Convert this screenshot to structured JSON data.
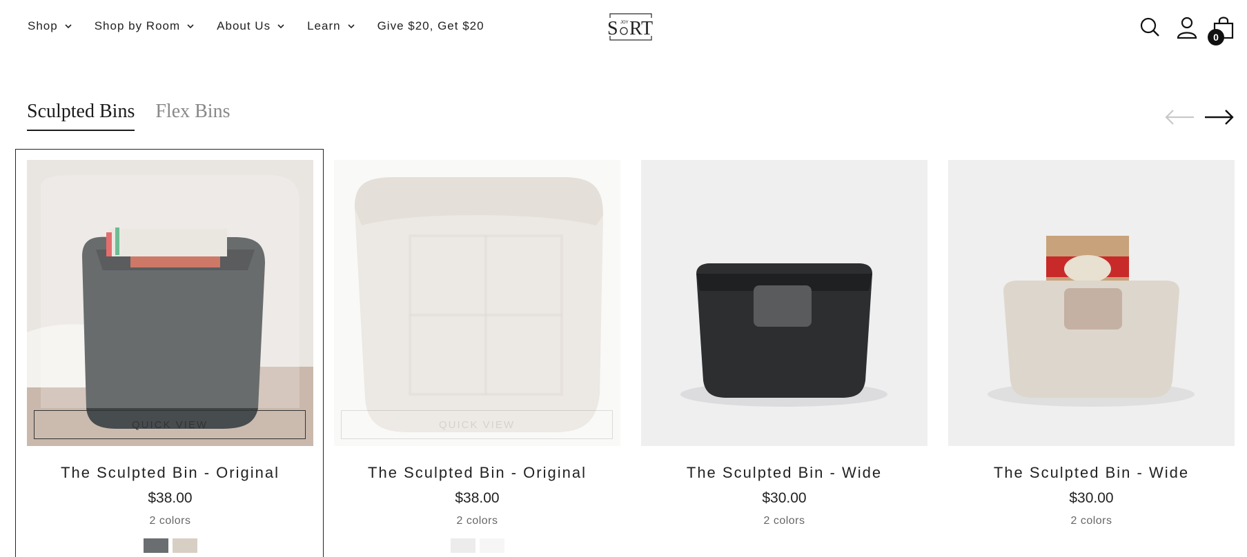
{
  "nav": {
    "items": [
      {
        "label": "Shop",
        "dropdown": true
      },
      {
        "label": "Shop by Room",
        "dropdown": true
      },
      {
        "label": "About Us",
        "dropdown": true
      },
      {
        "label": "Learn",
        "dropdown": true
      },
      {
        "label": "Give $20, Get $20",
        "dropdown": false
      }
    ]
  },
  "logo": {
    "text_main": "S RT",
    "text_small": "JOY"
  },
  "cart": {
    "count": "0"
  },
  "tabs": [
    {
      "label": "Sculpted Bins",
      "active": true
    },
    {
      "label": "Flex Bins",
      "active": false
    }
  ],
  "products": [
    {
      "title": "The Sculpted Bin - Original",
      "price": "$38.00",
      "colors": "2 colors",
      "quick_view": "QUICK VIEW",
      "swatches": [
        "#6b6e70",
        "#d8cfc4"
      ]
    },
    {
      "title": "The Sculpted Bin - Original",
      "price": "$38.00",
      "colors": "2 colors",
      "quick_view": "QUICK VIEW",
      "swatches": [
        "#ececec",
        "#f6f6f6"
      ]
    },
    {
      "title": "The Sculpted Bin - Wide",
      "price": "$30.00",
      "colors": "2 colors"
    },
    {
      "title": "The Sculpted Bin - Wide",
      "price": "$30.00",
      "colors": "2 colors"
    }
  ],
  "colors": {
    "text": "#1a1a1a",
    "muted": "#888888",
    "accent": "#111111"
  }
}
